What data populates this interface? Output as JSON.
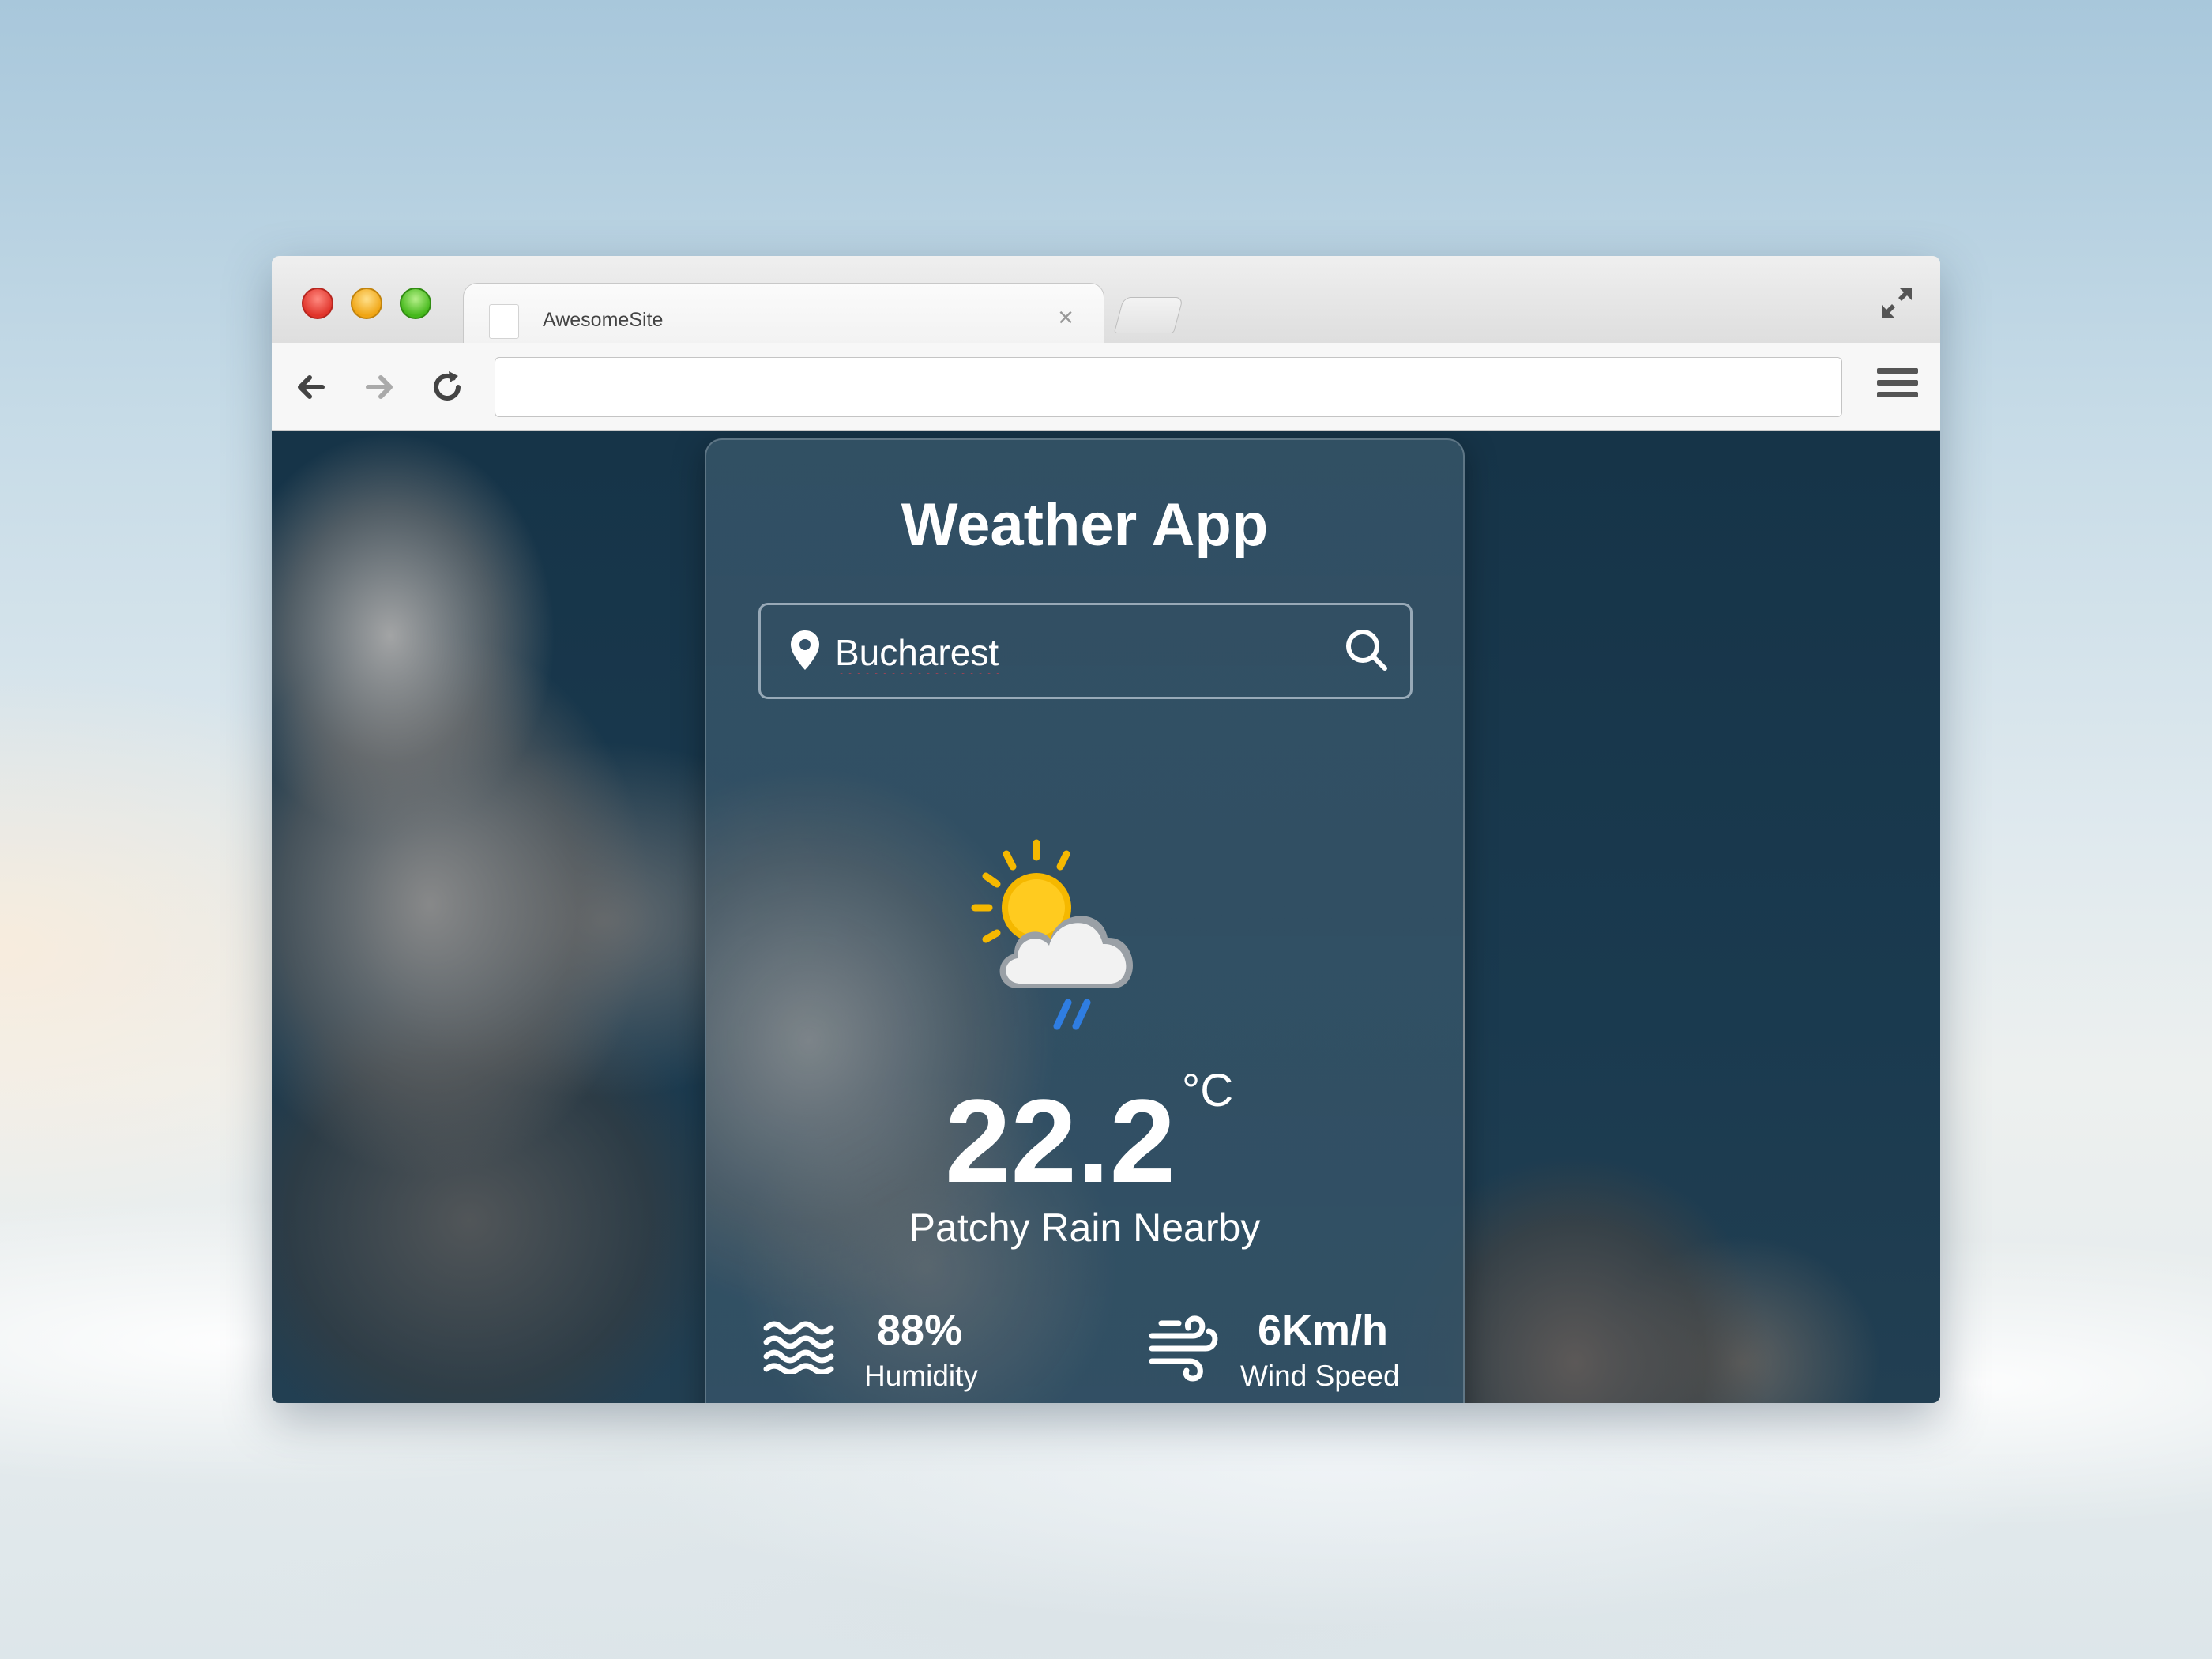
{
  "browser": {
    "tab_title": "AwesomeSite",
    "tab_close": "×",
    "address_value": "",
    "icons": {
      "back": "arrow-left-icon",
      "forward": "arrow-right-icon",
      "reload": "reload-icon",
      "menu": "hamburger-menu-icon",
      "fullscreen": "expand-icon"
    }
  },
  "app": {
    "title": "Weather App",
    "search": {
      "value": "Bucharest",
      "pin_icon": "location-pin-icon",
      "search_icon": "magnifier-icon"
    },
    "weather": {
      "icon": "sun-cloud-rain-icon",
      "temperature": "22.2",
      "unit": "°C",
      "condition": "Patchy Rain Nearby"
    },
    "humidity": {
      "value": "88%",
      "label": "Humidity",
      "icon": "waves-icon"
    },
    "wind": {
      "value": "6Km/h",
      "label": "Wind Speed",
      "icon": "wind-icon"
    }
  },
  "colors": {
    "card_background": "#345266",
    "page_background": "#1a3a4f",
    "text": "#ffffff",
    "sun": "#f5b800",
    "rain": "#2f7de1"
  }
}
